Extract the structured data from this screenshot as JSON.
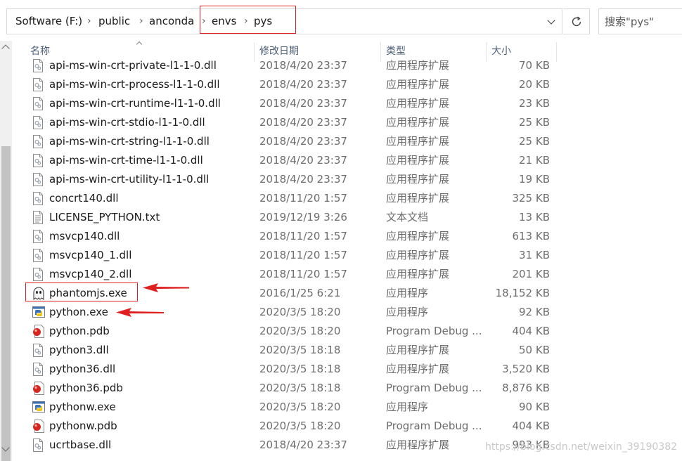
{
  "address_bar": {
    "breadcrumbs": [
      "Software (F:)",
      "public",
      "anconda",
      "envs",
      "pys"
    ],
    "search_placeholder": "搜索\"pys\""
  },
  "columns": {
    "name": "名称",
    "date": "修改日期",
    "type": "类型",
    "size": "大小"
  },
  "files": [
    {
      "name": "api-ms-win-crt-private-l1-1-0.dll",
      "date": "2018/4/20 23:37",
      "type": "应用程序扩展",
      "size": "70 KB",
      "icon": "dll-icon"
    },
    {
      "name": "api-ms-win-crt-process-l1-1-0.dll",
      "date": "2018/4/20 23:37",
      "type": "应用程序扩展",
      "size": "20 KB",
      "icon": "dll-icon"
    },
    {
      "name": "api-ms-win-crt-runtime-l1-1-0.dll",
      "date": "2018/4/20 23:37",
      "type": "应用程序扩展",
      "size": "23 KB",
      "icon": "dll-icon"
    },
    {
      "name": "api-ms-win-crt-stdio-l1-1-0.dll",
      "date": "2018/4/20 23:37",
      "type": "应用程序扩展",
      "size": "25 KB",
      "icon": "dll-icon"
    },
    {
      "name": "api-ms-win-crt-string-l1-1-0.dll",
      "date": "2018/4/20 23:37",
      "type": "应用程序扩展",
      "size": "25 KB",
      "icon": "dll-icon"
    },
    {
      "name": "api-ms-win-crt-time-l1-1-0.dll",
      "date": "2018/4/20 23:37",
      "type": "应用程序扩展",
      "size": "21 KB",
      "icon": "dll-icon"
    },
    {
      "name": "api-ms-win-crt-utility-l1-1-0.dll",
      "date": "2018/4/20 23:37",
      "type": "应用程序扩展",
      "size": "19 KB",
      "icon": "dll-icon"
    },
    {
      "name": "concrt140.dll",
      "date": "2018/11/20 1:57",
      "type": "应用程序扩展",
      "size": "325 KB",
      "icon": "dll-icon"
    },
    {
      "name": "LICENSE_PYTHON.txt",
      "date": "2019/12/19 3:26",
      "type": "文本文档",
      "size": "13 KB",
      "icon": "text-file-icon"
    },
    {
      "name": "msvcp140.dll",
      "date": "2018/11/20 1:57",
      "type": "应用程序扩展",
      "size": "613 KB",
      "icon": "dll-icon"
    },
    {
      "name": "msvcp140_1.dll",
      "date": "2018/11/20 1:57",
      "type": "应用程序扩展",
      "size": "31 KB",
      "icon": "dll-icon"
    },
    {
      "name": "msvcp140_2.dll",
      "date": "2018/11/20 1:57",
      "type": "应用程序扩展",
      "size": "201 KB",
      "icon": "dll-icon"
    },
    {
      "name": "phantomjs.exe",
      "date": "2016/1/25 6:21",
      "type": "应用程序",
      "size": "18,152 KB",
      "icon": "phantomjs-ghost-icon"
    },
    {
      "name": "python.exe",
      "date": "2020/3/5 18:20",
      "type": "应用程序",
      "size": "92 KB",
      "icon": "python-exe-icon"
    },
    {
      "name": "python.pdb",
      "date": "2020/3/5 18:20",
      "type": "Program Debug ...",
      "size": "404 KB",
      "icon": "pdb-file-icon"
    },
    {
      "name": "python3.dll",
      "date": "2020/3/5 18:18",
      "type": "应用程序扩展",
      "size": "50 KB",
      "icon": "dll-icon"
    },
    {
      "name": "python36.dll",
      "date": "2020/3/5 18:18",
      "type": "应用程序扩展",
      "size": "3,520 KB",
      "icon": "dll-icon"
    },
    {
      "name": "python36.pdb",
      "date": "2020/3/5 18:18",
      "type": "Program Debug ...",
      "size": "8,876 KB",
      "icon": "pdb-file-icon"
    },
    {
      "name": "pythonw.exe",
      "date": "2020/3/5 18:20",
      "type": "应用程序",
      "size": "90 KB",
      "icon": "python-exe-icon"
    },
    {
      "name": "pythonw.pdb",
      "date": "2020/3/5 18:20",
      "type": "Program Debug ...",
      "size": "404 KB",
      "icon": "pdb-file-icon"
    },
    {
      "name": "ucrtbase.dll",
      "date": "2018/4/20 23:37",
      "type": "应用程序扩展",
      "size": "993 KB",
      "icon": "dll-icon"
    }
  ],
  "watermark": "https://blog.csdn.net/weixin_39190382",
  "colors": {
    "annotation_red": "#e02020",
    "header_text": "#4c607a"
  }
}
